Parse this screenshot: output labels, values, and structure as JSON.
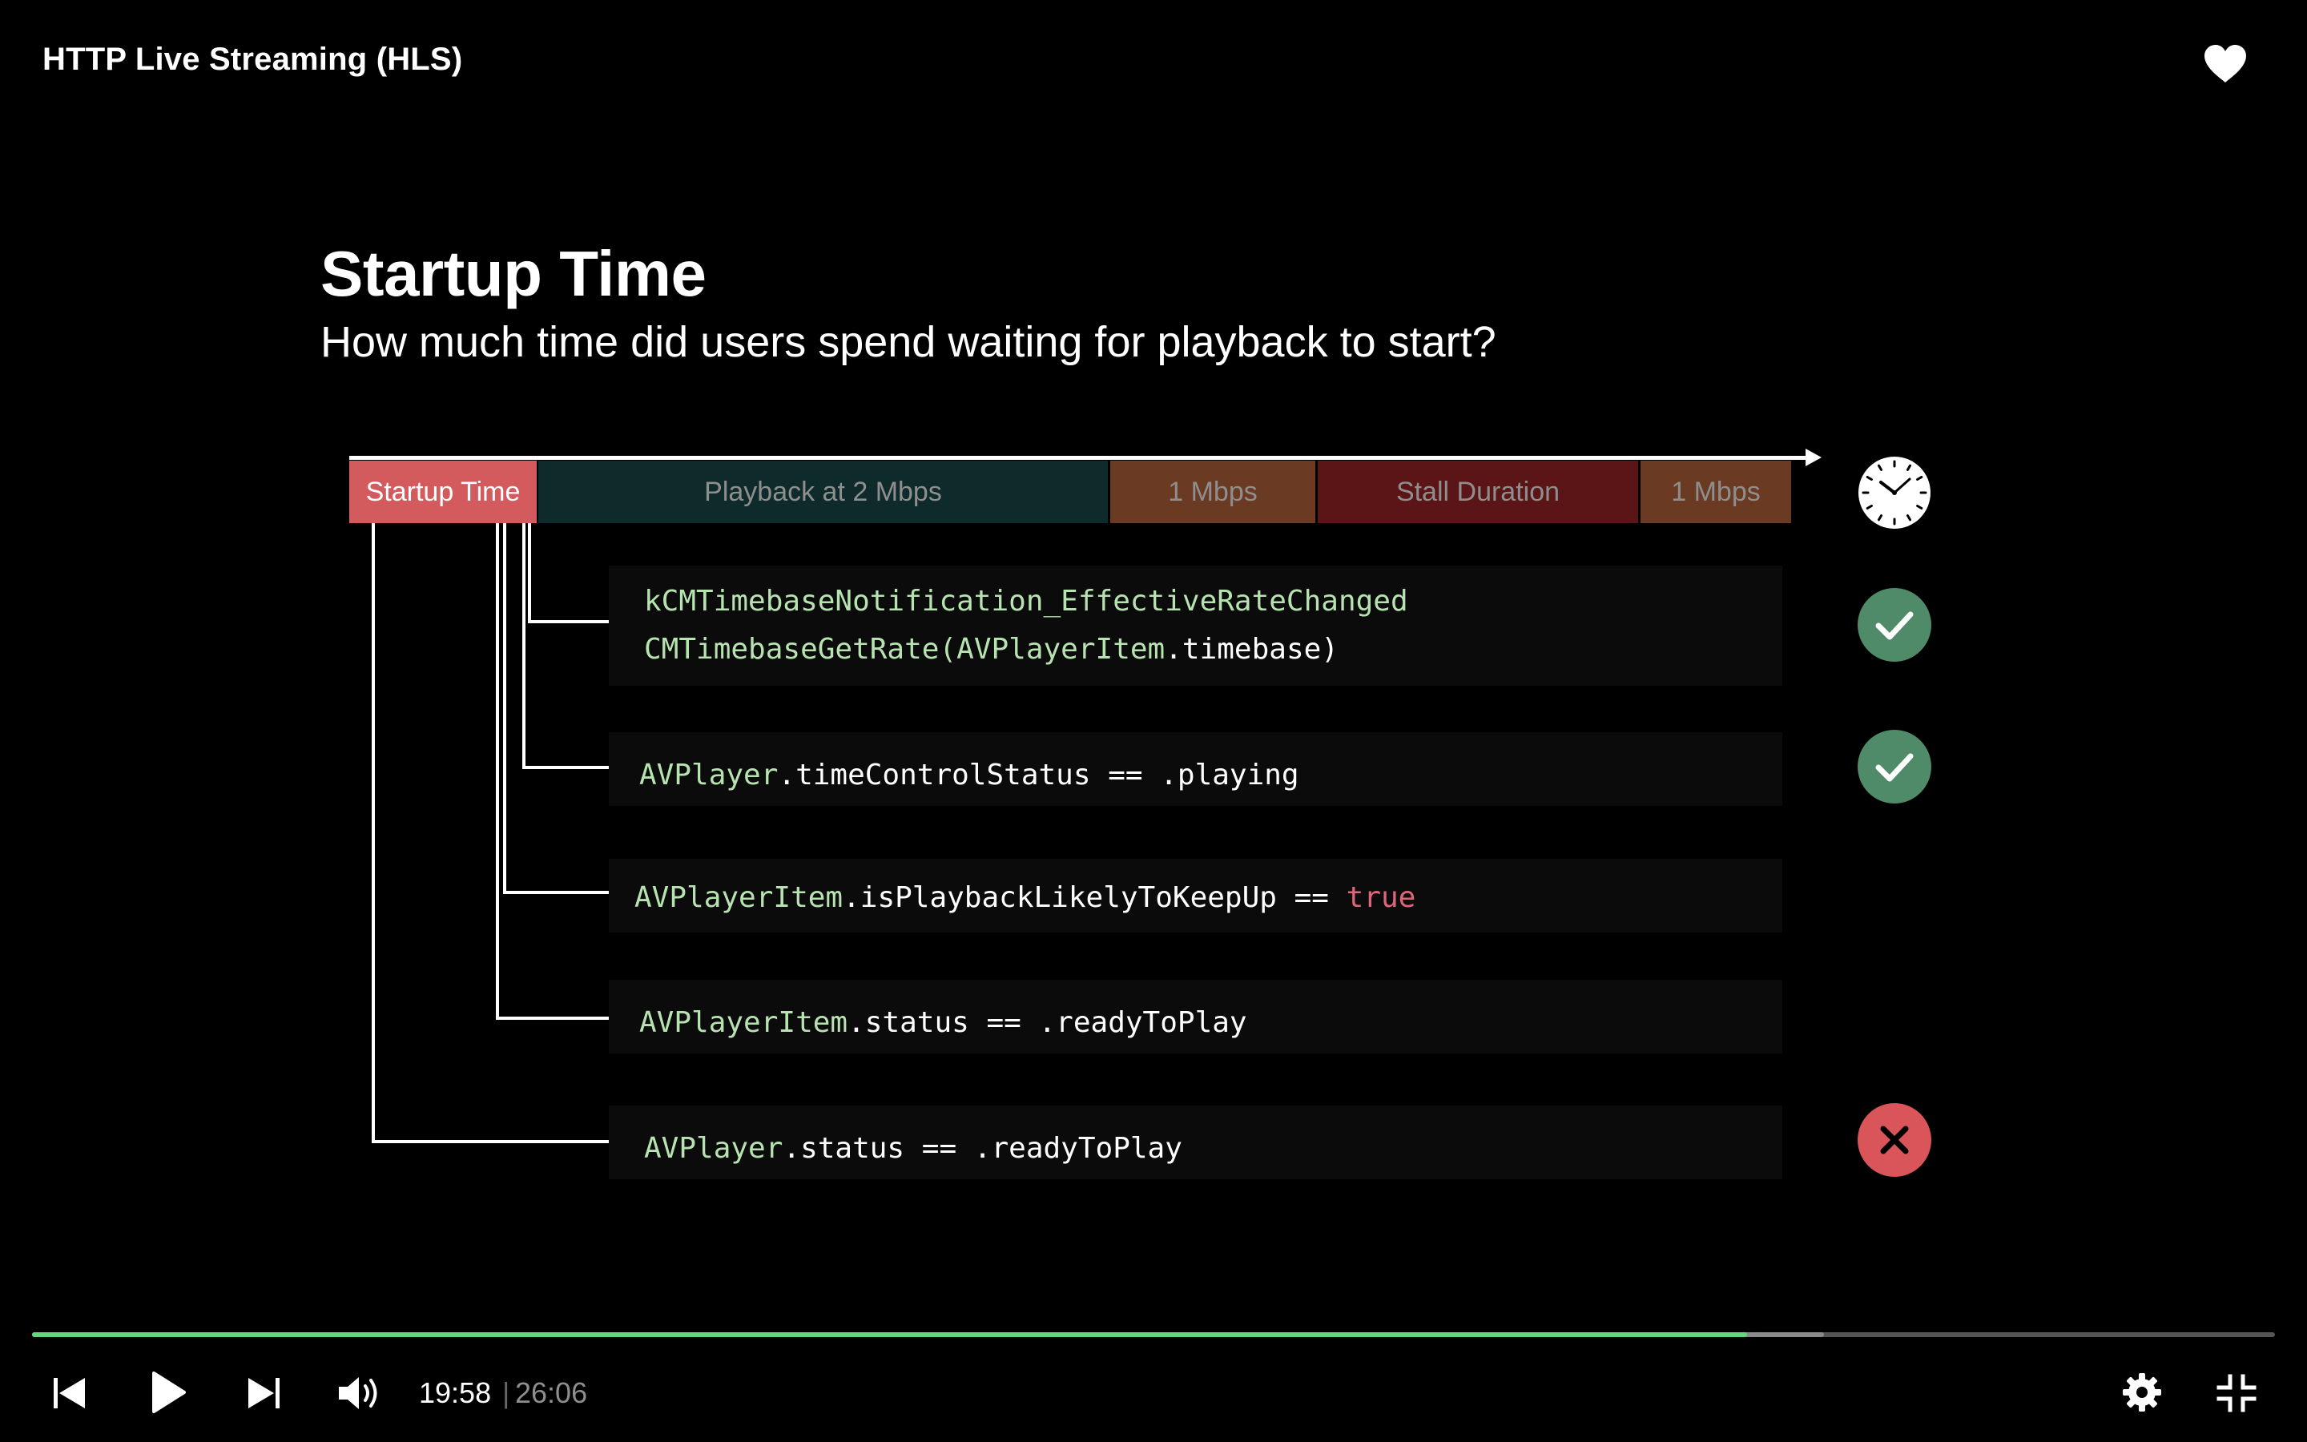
{
  "player": {
    "title": "HTTP Live Streaming (HLS)",
    "current_time": "19:58",
    "separator": "|",
    "total_time": "26:06",
    "progress_fraction": 0.7648,
    "buffered_fraction": 0.7991,
    "accent_color": "#62d87c",
    "icons": [
      "heart-icon",
      "skip-back-icon",
      "play-icon",
      "skip-forward-icon",
      "volume-icon",
      "gear-icon",
      "exit-fullscreen-icon"
    ]
  },
  "slide": {
    "title": "Startup Time",
    "subtitle": "How much time did users spend waiting for playback to start?",
    "timeline": {
      "segments": [
        "Startup Time",
        "Playback at 2 Mbps",
        "1 Mbps",
        "Stall Duration",
        "1 Mbps"
      ]
    },
    "rows": [
      {
        "line1": "kCMTimebaseNotification_EffectiveRateChanged",
        "line2_a": "CMTimebaseGetRate(",
        "line2_b": "AVPlayerItem",
        "line2_c": ".timebase)",
        "status": "check"
      },
      {
        "a": "AVPlayer",
        "b": ".timeControlStatus == .playing",
        "status": "check"
      },
      {
        "a": "AVPlayerItem",
        "b": ".isPlaybackLikelyToKeepUp == ",
        "c": "true",
        "status": "none"
      },
      {
        "a": "AVPlayerItem",
        "b": ".status == .readyToPlay",
        "status": "none"
      },
      {
        "a": "AVPlayer",
        "b": ".status == .readyToPlay",
        "status": "cross"
      }
    ],
    "colors": {
      "check": "#4f8a69",
      "cross": "#d9555a",
      "startup": "#d35a5d"
    }
  }
}
